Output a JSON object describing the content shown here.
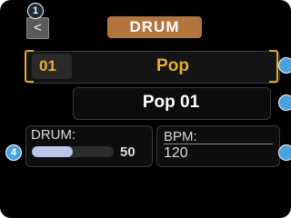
{
  "header": {
    "back_label": "<",
    "title": "DRUM"
  },
  "kit": {
    "number": "01",
    "name": "Pop"
  },
  "pattern": {
    "name": "Pop 01"
  },
  "drum_level": {
    "label": "DRUM:",
    "value": "50",
    "fraction": 0.5
  },
  "bpm": {
    "label": "BPM:",
    "value": "120"
  },
  "callouts": {
    "c1": "1",
    "c4": "4"
  },
  "colors": {
    "accent_orange": "#e6ae36",
    "title_badge": "#b4743e",
    "slider_fill": "#b9c7ea",
    "callout_blue": "#4aa2e0",
    "callout_dark": "#1a2a3a"
  }
}
